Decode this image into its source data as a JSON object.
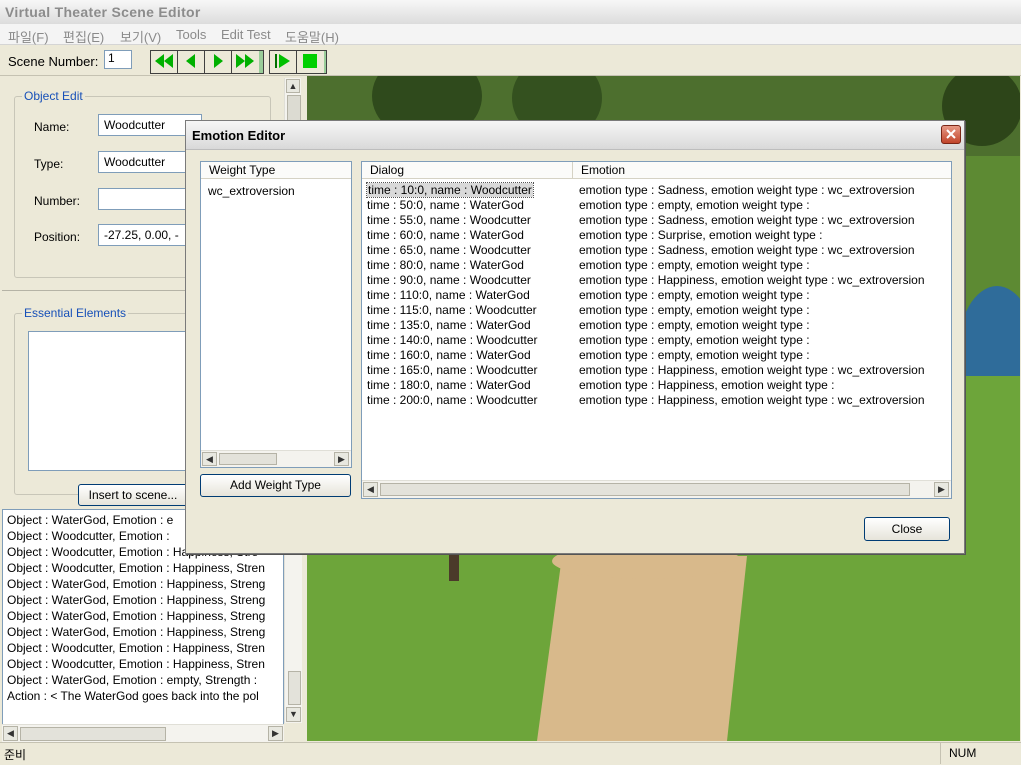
{
  "app": {
    "title": "Virtual Theater Scene Editor"
  },
  "menu": [
    "파일(F)",
    "편집(E)",
    "보기(V)",
    "Tools",
    "Edit Test",
    "도움말(H)"
  ],
  "toolbar": {
    "scene_label": "Scene Number:",
    "scene_value": "1"
  },
  "object_edit": {
    "title": "Object Edit",
    "name_label": "Name:",
    "name_value": "Woodcutter",
    "type_label": "Type:",
    "type_value": "Woodcutter",
    "number_label": "Number:",
    "number_value": "",
    "position_label": "Position:",
    "position_value": "-27.25, 0.00, -"
  },
  "essential": {
    "title": "Essential Elements",
    "insert_label": "Insert to scene..."
  },
  "log": [
    "Object : WaterGod, Emotion : e",
    "Object : Woodcutter, Emotion :",
    "Object : Woodcutter, Emotion : Happiness, Stre",
    "Object : Woodcutter, Emotion : Happiness, Stren",
    "Object : WaterGod, Emotion : Happiness, Streng",
    "Object : WaterGod, Emotion : Happiness, Streng",
    "Object : WaterGod, Emotion : Happiness, Streng",
    "Object : WaterGod, Emotion : Happiness, Streng",
    "Object : Woodcutter, Emotion : Happiness, Stren",
    "Object : Woodcutter, Emotion : Happiness, Stren",
    "Object : WaterGod, Emotion : empty, Strength :",
    "Action : < The WaterGod goes back into the pol"
  ],
  "dialog": {
    "title": "Emotion Editor",
    "weight_header": "Weight Type",
    "weight_items": [
      "wc_extroversion"
    ],
    "add_weight_label": "Add Weight Type",
    "dialog_header": "Dialog",
    "emotion_header": "Emotion",
    "close_label": "Close",
    "rows": [
      {
        "dialog": "time : 10:0, name : Woodcutter",
        "emotion": "emotion type : Sadness, emotion weight type : wc_extroversion"
      },
      {
        "dialog": "time : 50:0, name : WaterGod",
        "emotion": "emotion type : empty, emotion weight type :"
      },
      {
        "dialog": "time : 55:0, name : Woodcutter",
        "emotion": "emotion type : Sadness, emotion weight type : wc_extroversion"
      },
      {
        "dialog": "time : 60:0, name : WaterGod",
        "emotion": "emotion type : Surprise, emotion weight type :"
      },
      {
        "dialog": "time : 65:0, name : Woodcutter",
        "emotion": "emotion type : Sadness, emotion weight type : wc_extroversion"
      },
      {
        "dialog": "time : 80:0, name : WaterGod",
        "emotion": "emotion type : empty, emotion weight type :"
      },
      {
        "dialog": "time : 90:0, name : Woodcutter",
        "emotion": "emotion type : Happiness, emotion weight type : wc_extroversion"
      },
      {
        "dialog": "time : 110:0, name : WaterGod",
        "emotion": "emotion type : empty, emotion weight type :"
      },
      {
        "dialog": "time : 115:0, name : Woodcutter",
        "emotion": "emotion type : empty, emotion weight type :"
      },
      {
        "dialog": "time : 135:0, name : WaterGod",
        "emotion": "emotion type : empty, emotion weight type :"
      },
      {
        "dialog": "time : 140:0, name : Woodcutter",
        "emotion": "emotion type : empty, emotion weight type :"
      },
      {
        "dialog": "time : 160:0, name : WaterGod",
        "emotion": "emotion type : empty, emotion weight type :"
      },
      {
        "dialog": "time : 165:0, name : Woodcutter",
        "emotion": "emotion type : Happiness, emotion weight type : wc_extroversion"
      },
      {
        "dialog": "time : 180:0, name : WaterGod",
        "emotion": "emotion type : Happiness, emotion weight type :"
      },
      {
        "dialog": "time : 200:0, name : Woodcutter",
        "emotion": "emotion type : Happiness, emotion weight type : wc_extroversion"
      }
    ]
  },
  "status": {
    "left": "준비",
    "right": "NUM"
  },
  "colors": {
    "accent_blue": "#1750b8",
    "toolbar_green": "#00c000",
    "close_red": "#c1452a"
  }
}
